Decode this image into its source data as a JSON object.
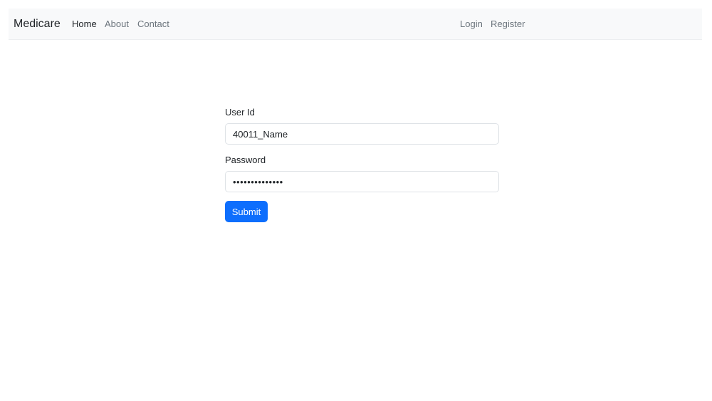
{
  "navbar": {
    "brand": "Medicare",
    "links": [
      {
        "label": "Home",
        "active": true
      },
      {
        "label": "About",
        "active": false
      },
      {
        "label": "Contact",
        "active": false
      }
    ],
    "right_links": [
      {
        "label": "Login"
      },
      {
        "label": "Register"
      }
    ],
    "background": "#f8f9fa"
  },
  "form": {
    "userid_label": "User Id",
    "userid_value": "40011_Name",
    "password_label": "Password",
    "password_value": "••••••••••••••",
    "submit_label": "Submit"
  },
  "colors": {
    "primary": "#0d6efd",
    "text": "#212529",
    "muted": "#6c757d"
  }
}
